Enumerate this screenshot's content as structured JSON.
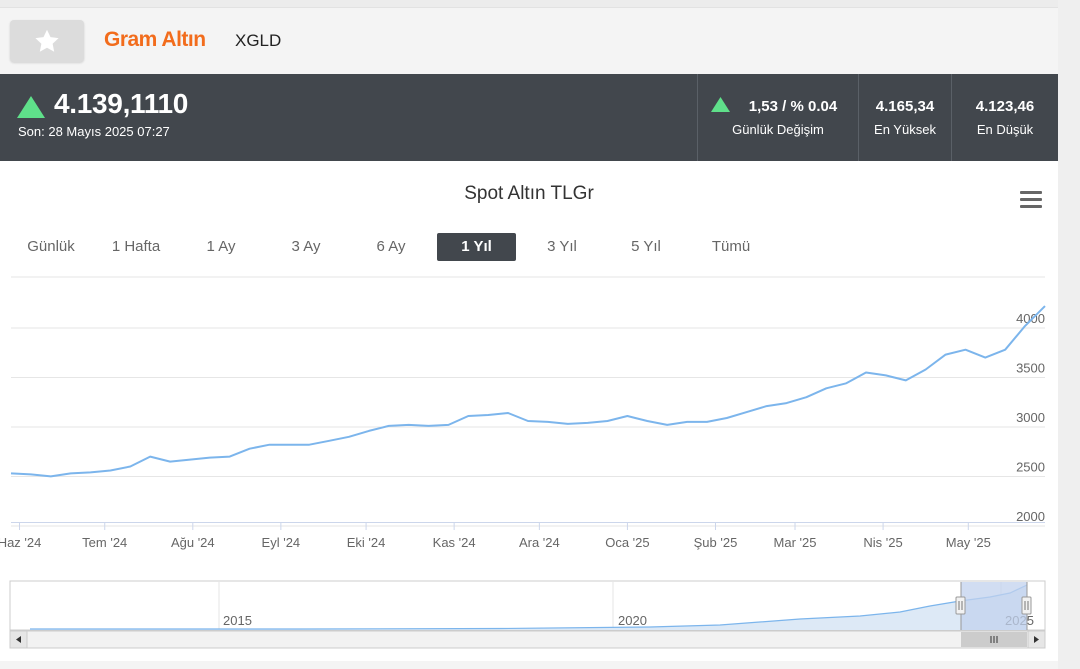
{
  "header": {
    "title": "Gram Altın",
    "code": "XGLD"
  },
  "quote": {
    "price": "4.139,1110",
    "last_update": "Son: 28 Mayıs 2025 07:27",
    "change_value": "1,53 / % 0.04",
    "change_label": "Günlük Değişim",
    "high_value": "4.165,34",
    "high_label": "En Yüksek",
    "low_value": "4.123,46",
    "low_label": "En Düşük",
    "up_color": "#5fe08a"
  },
  "range_buttons": [
    "Günlük",
    "1 Hafta",
    "1 Ay",
    "3 Ay",
    "6 Ay",
    "1 Yıl",
    "3 Yıl",
    "5 Yıl",
    "Tümü"
  ],
  "range_selected": "1 Yıl",
  "icons": {
    "favorite": "star-icon",
    "menu": "hamburger-menu-icon",
    "trend": "triangle-up-icon"
  },
  "colors": {
    "title": "#f26c1c",
    "quote_bg": "#42474d",
    "line": "#7cb5ec",
    "navigator_mask": "#c2d2ee"
  },
  "navigator": {
    "year_labels": [
      "2015",
      "2020",
      "2025"
    ]
  },
  "chart_data": {
    "type": "line",
    "title": "Spot Altın TLGr",
    "xlabel": "",
    "ylabel": "",
    "ylim": [
      2000,
      4000
    ],
    "yticks": [
      2000,
      2500,
      3000,
      3500,
      4000
    ],
    "xticks": [
      "Haz '24",
      "Tem '24",
      "Ağu '24",
      "Eyl '24",
      "Eki '24",
      "Kas '24",
      "Ara '24",
      "Oca '25",
      "Şub '25",
      "Mar '25",
      "Nis '25",
      "May '25"
    ],
    "series": [
      {
        "x": [
          "2024-05-29",
          "2024-06-05",
          "2024-06-12",
          "2024-06-19",
          "2024-06-26",
          "2024-07-03",
          "2024-07-10",
          "2024-07-17",
          "2024-07-24",
          "2024-07-31",
          "2024-08-07",
          "2024-08-14",
          "2024-08-21",
          "2024-08-28",
          "2024-09-04",
          "2024-09-11",
          "2024-09-18",
          "2024-09-25",
          "2024-10-02",
          "2024-10-09",
          "2024-10-16",
          "2024-10-23",
          "2024-10-30",
          "2024-11-06",
          "2024-11-13",
          "2024-11-20",
          "2024-11-27",
          "2024-12-04",
          "2024-12-11",
          "2024-12-18",
          "2024-12-25",
          "2025-01-01",
          "2025-01-08",
          "2025-01-15",
          "2025-01-22",
          "2025-01-29",
          "2025-02-05",
          "2025-02-12",
          "2025-02-19",
          "2025-02-26",
          "2025-03-05",
          "2025-03-12",
          "2025-03-19",
          "2025-03-26",
          "2025-04-02",
          "2025-04-09",
          "2025-04-16",
          "2025-04-23",
          "2025-04-30",
          "2025-05-07",
          "2025-05-14",
          "2025-05-21",
          "2025-05-28"
        ],
        "values": [
          2430,
          2420,
          2400,
          2430,
          2440,
          2460,
          2500,
          2600,
          2550,
          2570,
          2590,
          2600,
          2680,
          2720,
          2720,
          2720,
          2760,
          2800,
          2860,
          2910,
          2920,
          2910,
          2920,
          3010,
          3020,
          3040,
          2960,
          2950,
          2930,
          2940,
          2960,
          3010,
          2960,
          2920,
          2950,
          2950,
          2990,
          3050,
          3110,
          3140,
          3200,
          3290,
          3340,
          3450,
          3420,
          3370,
          3480,
          3630,
          3680,
          3600,
          3680,
          3920,
          4120
        ]
      }
    ],
    "grid": "horizontal",
    "legend": "none"
  }
}
